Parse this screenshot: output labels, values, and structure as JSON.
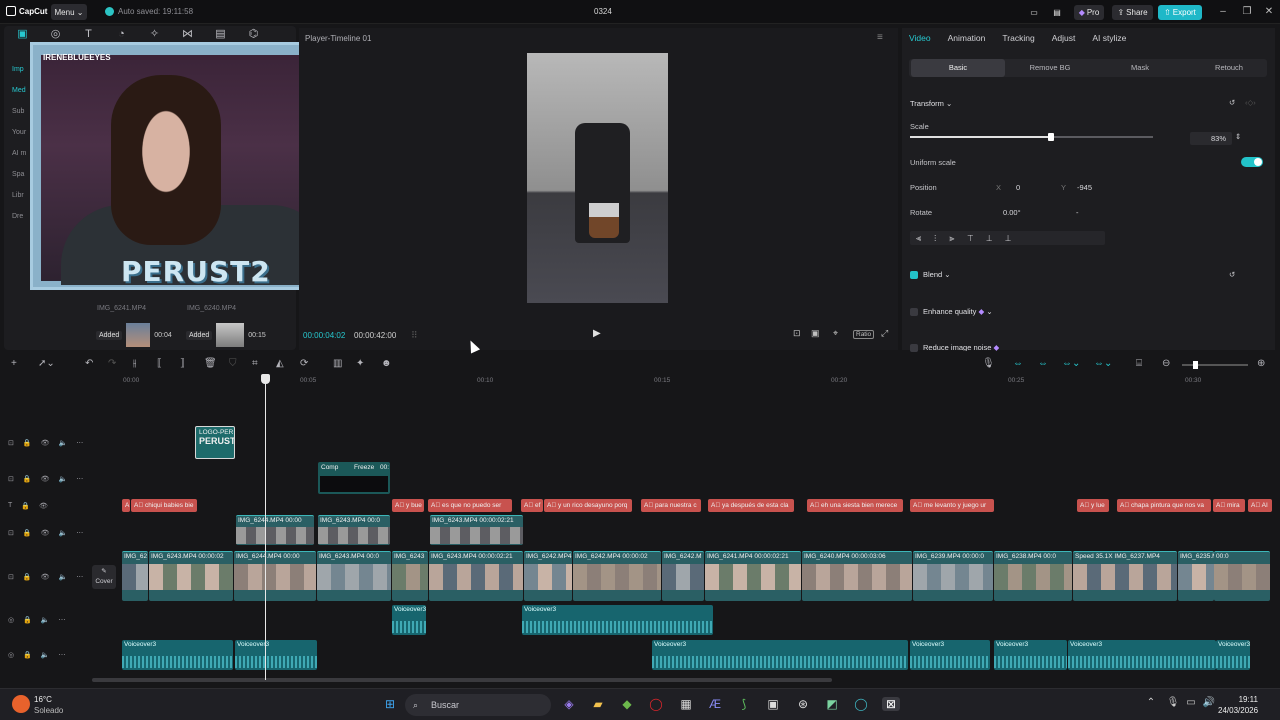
{
  "titlebar": {
    "app": "CapCut",
    "menu": "Menu",
    "autosave": "Auto saved: 19:11:58",
    "project": "0324",
    "pro": "Pro",
    "share": "Share",
    "export": "Export"
  },
  "media": {
    "sidetabs": [
      "Imp",
      "Med",
      "Sub",
      "Your",
      "AI m",
      "Spa",
      "Libr",
      "Dre"
    ],
    "webcam_channel": "IRENEBLUEEYES",
    "webcam_brand": "PERUST2",
    "thumb_labels": [
      "IMG_6241.MP4",
      "IMG_6240.MP4"
    ],
    "added": [
      {
        "label": "Added",
        "time": "00:04"
      },
      {
        "label": "Added",
        "time": "00:15"
      }
    ]
  },
  "player": {
    "title": "Player-Timeline 01",
    "current": "00:00:04:02",
    "total": "00:00:42:00",
    "ratio": "Ratio"
  },
  "inspector": {
    "tabs": [
      "Video",
      "Animation",
      "Tracking",
      "Adjust",
      "AI stylize"
    ],
    "subtabs": [
      "Basic",
      "Remove BG",
      "Mask",
      "Retouch"
    ],
    "transform": "Transform",
    "scale_label": "Scale",
    "scale_value": "83%",
    "scale_fraction": 0.83,
    "uniform": "Uniform scale",
    "position": "Position",
    "pos_x_label": "X",
    "pos_x": "0",
    "pos_y_label": "Y",
    "pos_y": "-945",
    "rotate": "Rotate",
    "rotate_val": "0.00°",
    "rotate_dash": "-",
    "blend": "Blend",
    "enhance": "Enhance quality",
    "noise": "Reduce image noise"
  },
  "colors": {
    "accent": "#27c9d0",
    "export": "#1fb8c8",
    "textclip": "#c8524e",
    "videoclip": "#2a5f64",
    "audioclip": "#17656e"
  },
  "timeline": {
    "ruler": [
      "00:00",
      "00:05",
      "00:10",
      "00:15",
      "00:20",
      "00:25",
      "00:30"
    ],
    "cover": "Cover",
    "sticker": "LOGO-PER",
    "effects": [
      "Comp",
      "Freeze",
      "00:"
    ],
    "texts": [
      "A",
      "chiqui babies bie",
      "y bue",
      "es que no puedo ser",
      "ef",
      "y un rico desayuno porq",
      "para nuestra c",
      "ya después de esta cla",
      "eh una siesta bien merece",
      "me levanto y juego ur",
      "y lue",
      "chapa pintura que nos va",
      "mira",
      "AI"
    ],
    "overlay": [
      "IMG_6244.MP4",
      "00:00",
      "IMG_6243.MP4",
      "00:0",
      "IMG_6243.MP4",
      "00:00:02:21"
    ],
    "main": [
      "IMG_62",
      "IMG_6243.MP4",
      "00:00:02",
      "IMG_6244.MP4",
      "00:00",
      "IMG_6243.MP4",
      "00:0",
      "IMG_6243",
      "IMG_6243.MP4",
      "00:00:02:21",
      "IMG_6242.MP4",
      "IMG_6242.MP4",
      "00:00:02",
      "IMG_6242.M",
      "IMG_6241.MP4",
      "00:00:02:21",
      "IMG_6240.MP4",
      "00:00:03:06",
      "IMG_6239.MP4",
      "00:00:0",
      "IMG_6238.MP4",
      "00:0",
      "Speed 35.1X",
      "IMG_6237.MP4",
      "IMG_6235.MP4",
      "00:0"
    ],
    "voice1": [
      "Voiceover3",
      "Voiceover3"
    ],
    "voice2": [
      "Voiceover3",
      "Voiceover3",
      "Voiceover3",
      "Voiceover3",
      "Voiceover3",
      "Voiceover3",
      "Voiceover3"
    ]
  },
  "taskbar": {
    "temp": "16°C",
    "weather": "Soleado",
    "search": "Buscar",
    "time": "19:11",
    "date": "24/03/2026"
  }
}
